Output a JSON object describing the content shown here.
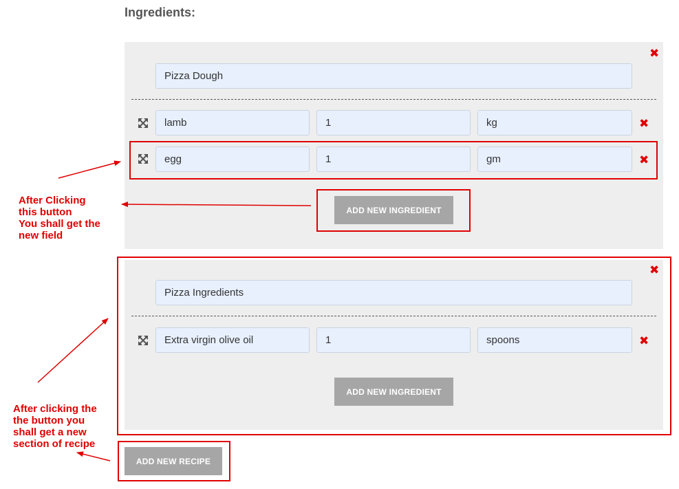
{
  "page": {
    "heading": "Ingredients:"
  },
  "recipes": [
    {
      "name": "Pizza Dough",
      "ingredients": [
        {
          "name": "lamb",
          "quantity": "1",
          "unit": "kg"
        },
        {
          "name": "egg",
          "quantity": "1",
          "unit": "gm"
        }
      ],
      "add_ingredient_label": "ADD NEW INGREDIENT"
    },
    {
      "name": "Pizza Ingredients",
      "ingredients": [
        {
          "name": "Extra virgin olive oil",
          "quantity": "1",
          "unit": "spoons"
        }
      ],
      "add_ingredient_label": "ADD NEW INGREDIENT"
    }
  ],
  "add_recipe_label": "ADD NEW RECIPE",
  "annotations": {
    "note1": "After Clicking\nthis button\nYou shall get the\nnew field",
    "note2": "After clicking the\nthe button you\nshall get a new\nsection of recipe",
    "color": "#e00000"
  },
  "icons": {
    "delete": "close-x-icon",
    "drag": "move-arrows-icon"
  },
  "colors": {
    "section_bg": "#eeeeee",
    "field_bg": "#e8f0fe",
    "button_bg": "#a6a6a6",
    "delete": "#e00000"
  }
}
